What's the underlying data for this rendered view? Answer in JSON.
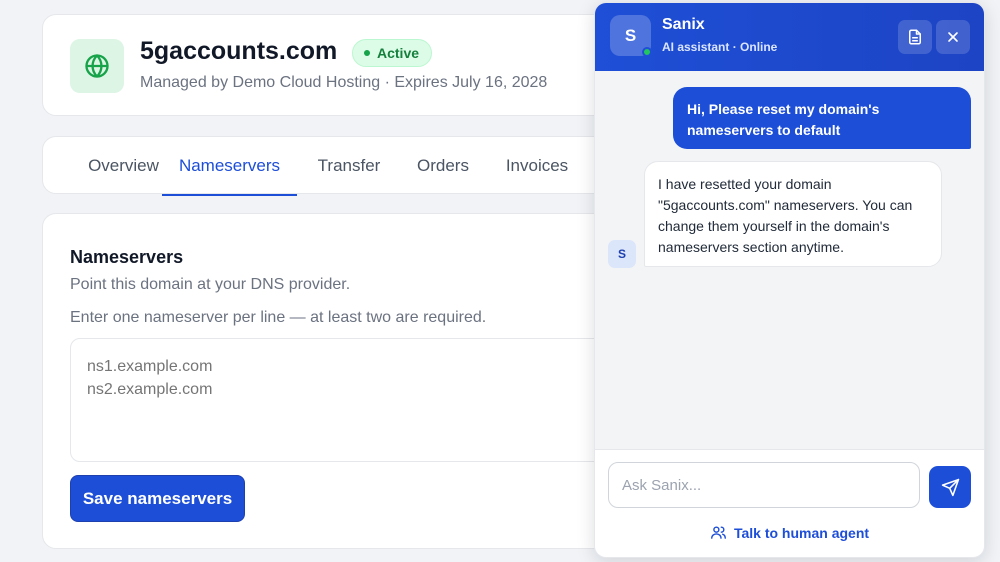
{
  "domain": {
    "name": "5gaccounts.com",
    "status": "Active",
    "subtitle": "Managed by Demo Cloud Hosting · Expires July 16, 2028",
    "icon": "globe-icon"
  },
  "tabs": [
    {
      "label": "Overview",
      "active": false
    },
    {
      "label": "Nameservers",
      "active": true
    },
    {
      "label": "Transfer",
      "active": false
    },
    {
      "label": "Orders",
      "active": false
    },
    {
      "label": "Invoices",
      "active": false
    }
  ],
  "nameservers": {
    "title": "Nameservers",
    "subtitle": "Point this domain at your DNS provider.",
    "help": "Enter one nameserver per line — at least two are required.",
    "placeholder": "ns1.example.com\nns2.example.com",
    "value": "",
    "save_label": "Save nameservers"
  },
  "chat": {
    "avatar_letter": "S",
    "name": "Sanix",
    "status": "AI assistant · Online",
    "messages": [
      {
        "from": "user",
        "text": "Hi, Please reset my domain's nameservers to default"
      },
      {
        "from": "bot",
        "avatar": "S",
        "text": "I have resetted your domain \"5gaccounts.com\" nameservers. You can change them yourself in the domain's nameservers section anytime."
      }
    ],
    "input_placeholder": "Ask Sanix...",
    "human_agent_label": "Talk to human agent"
  },
  "colors": {
    "accent": "#1d4ed8",
    "status_active": "#15803d",
    "online": "#22c55e"
  }
}
